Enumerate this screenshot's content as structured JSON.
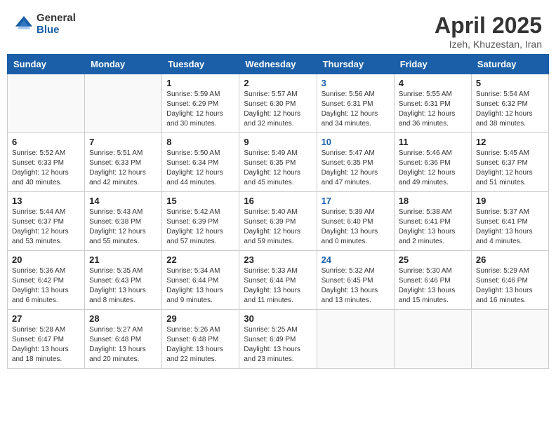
{
  "header": {
    "logo_general": "General",
    "logo_blue": "Blue",
    "month_title": "April 2025",
    "location": "Izeh, Khuzestan, Iran"
  },
  "weekdays": [
    "Sunday",
    "Monday",
    "Tuesday",
    "Wednesday",
    "Thursday",
    "Friday",
    "Saturday"
  ],
  "days": [
    {
      "num": "",
      "sunrise": "",
      "sunset": "",
      "daylight": ""
    },
    {
      "num": "",
      "sunrise": "",
      "sunset": "",
      "daylight": ""
    },
    {
      "num": "1",
      "sunrise": "Sunrise: 5:59 AM",
      "sunset": "Sunset: 6:29 PM",
      "daylight": "Daylight: 12 hours and 30 minutes."
    },
    {
      "num": "2",
      "sunrise": "Sunrise: 5:57 AM",
      "sunset": "Sunset: 6:30 PM",
      "daylight": "Daylight: 12 hours and 32 minutes."
    },
    {
      "num": "3",
      "sunrise": "Sunrise: 5:56 AM",
      "sunset": "Sunset: 6:31 PM",
      "daylight": "Daylight: 12 hours and 34 minutes.",
      "thursday": true
    },
    {
      "num": "4",
      "sunrise": "Sunrise: 5:55 AM",
      "sunset": "Sunset: 6:31 PM",
      "daylight": "Daylight: 12 hours and 36 minutes."
    },
    {
      "num": "5",
      "sunrise": "Sunrise: 5:54 AM",
      "sunset": "Sunset: 6:32 PM",
      "daylight": "Daylight: 12 hours and 38 minutes."
    },
    {
      "num": "6",
      "sunrise": "Sunrise: 5:52 AM",
      "sunset": "Sunset: 6:33 PM",
      "daylight": "Daylight: 12 hours and 40 minutes."
    },
    {
      "num": "7",
      "sunrise": "Sunrise: 5:51 AM",
      "sunset": "Sunset: 6:33 PM",
      "daylight": "Daylight: 12 hours and 42 minutes."
    },
    {
      "num": "8",
      "sunrise": "Sunrise: 5:50 AM",
      "sunset": "Sunset: 6:34 PM",
      "daylight": "Daylight: 12 hours and 44 minutes."
    },
    {
      "num": "9",
      "sunrise": "Sunrise: 5:49 AM",
      "sunset": "Sunset: 6:35 PM",
      "daylight": "Daylight: 12 hours and 45 minutes."
    },
    {
      "num": "10",
      "sunrise": "Sunrise: 5:47 AM",
      "sunset": "Sunset: 6:35 PM",
      "daylight": "Daylight: 12 hours and 47 minutes.",
      "thursday": true
    },
    {
      "num": "11",
      "sunrise": "Sunrise: 5:46 AM",
      "sunset": "Sunset: 6:36 PM",
      "daylight": "Daylight: 12 hours and 49 minutes."
    },
    {
      "num": "12",
      "sunrise": "Sunrise: 5:45 AM",
      "sunset": "Sunset: 6:37 PM",
      "daylight": "Daylight: 12 hours and 51 minutes."
    },
    {
      "num": "13",
      "sunrise": "Sunrise: 5:44 AM",
      "sunset": "Sunset: 6:37 PM",
      "daylight": "Daylight: 12 hours and 53 minutes."
    },
    {
      "num": "14",
      "sunrise": "Sunrise: 5:43 AM",
      "sunset": "Sunset: 6:38 PM",
      "daylight": "Daylight: 12 hours and 55 minutes."
    },
    {
      "num": "15",
      "sunrise": "Sunrise: 5:42 AM",
      "sunset": "Sunset: 6:39 PM",
      "daylight": "Daylight: 12 hours and 57 minutes."
    },
    {
      "num": "16",
      "sunrise": "Sunrise: 5:40 AM",
      "sunset": "Sunset: 6:39 PM",
      "daylight": "Daylight: 12 hours and 59 minutes."
    },
    {
      "num": "17",
      "sunrise": "Sunrise: 5:39 AM",
      "sunset": "Sunset: 6:40 PM",
      "daylight": "Daylight: 13 hours and 0 minutes.",
      "thursday": true
    },
    {
      "num": "18",
      "sunrise": "Sunrise: 5:38 AM",
      "sunset": "Sunset: 6:41 PM",
      "daylight": "Daylight: 13 hours and 2 minutes."
    },
    {
      "num": "19",
      "sunrise": "Sunrise: 5:37 AM",
      "sunset": "Sunset: 6:41 PM",
      "daylight": "Daylight: 13 hours and 4 minutes."
    },
    {
      "num": "20",
      "sunrise": "Sunrise: 5:36 AM",
      "sunset": "Sunset: 6:42 PM",
      "daylight": "Daylight: 13 hours and 6 minutes."
    },
    {
      "num": "21",
      "sunrise": "Sunrise: 5:35 AM",
      "sunset": "Sunset: 6:43 PM",
      "daylight": "Daylight: 13 hours and 8 minutes."
    },
    {
      "num": "22",
      "sunrise": "Sunrise: 5:34 AM",
      "sunset": "Sunset: 6:44 PM",
      "daylight": "Daylight: 13 hours and 9 minutes."
    },
    {
      "num": "23",
      "sunrise": "Sunrise: 5:33 AM",
      "sunset": "Sunset: 6:44 PM",
      "daylight": "Daylight: 13 hours and 11 minutes."
    },
    {
      "num": "24",
      "sunrise": "Sunrise: 5:32 AM",
      "sunset": "Sunset: 6:45 PM",
      "daylight": "Daylight: 13 hours and 13 minutes.",
      "thursday": true
    },
    {
      "num": "25",
      "sunrise": "Sunrise: 5:30 AM",
      "sunset": "Sunset: 6:46 PM",
      "daylight": "Daylight: 13 hours and 15 minutes."
    },
    {
      "num": "26",
      "sunrise": "Sunrise: 5:29 AM",
      "sunset": "Sunset: 6:46 PM",
      "daylight": "Daylight: 13 hours and 16 minutes."
    },
    {
      "num": "27",
      "sunrise": "Sunrise: 5:28 AM",
      "sunset": "Sunset: 6:47 PM",
      "daylight": "Daylight: 13 hours and 18 minutes."
    },
    {
      "num": "28",
      "sunrise": "Sunrise: 5:27 AM",
      "sunset": "Sunset: 6:48 PM",
      "daylight": "Daylight: 13 hours and 20 minutes."
    },
    {
      "num": "29",
      "sunrise": "Sunrise: 5:26 AM",
      "sunset": "Sunset: 6:48 PM",
      "daylight": "Daylight: 13 hours and 22 minutes."
    },
    {
      "num": "30",
      "sunrise": "Sunrise: 5:25 AM",
      "sunset": "Sunset: 6:49 PM",
      "daylight": "Daylight: 13 hours and 23 minutes."
    },
    {
      "num": "",
      "sunrise": "",
      "sunset": "",
      "daylight": ""
    },
    {
      "num": "",
      "sunrise": "",
      "sunset": "",
      "daylight": ""
    }
  ]
}
